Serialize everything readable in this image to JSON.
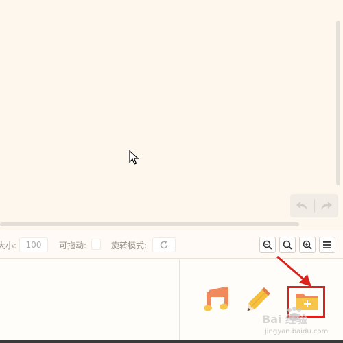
{
  "toolbar": {
    "size_label": "大小:",
    "size_value": "100",
    "drag_label": "可拖动:",
    "rotate_label": "旋转模式:"
  },
  "icons": {
    "undo": "undo-icon",
    "redo": "redo-icon",
    "rotate": "rotate-icon",
    "zoom_out": "zoom-out-icon",
    "zoom_reset": "zoom-reset-icon",
    "zoom_in": "zoom-in-icon",
    "menu": "menu-icon",
    "music": "music-icon",
    "pencil": "pencil-icon",
    "add_folder": "folder-add-icon"
  },
  "watermark": {
    "brand": "Bai 经验",
    "url": "jingyan.baidu.com"
  },
  "colors": {
    "background": "#fef7ee",
    "highlight": "#d9221c",
    "folder": "#f7c54a",
    "music": "#f08a5d",
    "pencil": "#f5c040"
  }
}
